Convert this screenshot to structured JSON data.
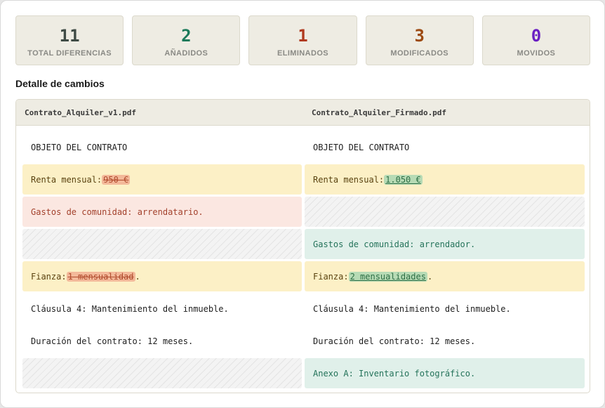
{
  "stats": [
    {
      "value": "11",
      "label": "TOTAL DIFERENCIAS",
      "color": "#3f4b45"
    },
    {
      "value": "2",
      "label": "AÑADIDOS",
      "color": "#1b7a5a"
    },
    {
      "value": "1",
      "label": "ELIMINADOS",
      "color": "#b03a1f"
    },
    {
      "value": "3",
      "label": "MODIFICADOS",
      "color": "#9c4a12"
    },
    {
      "value": "0",
      "label": "MOVIDOS",
      "color": "#6a1fc2"
    }
  ],
  "section_title": "Detalle de cambios",
  "files": {
    "left": "Contrato_Alquiler_v1.pdf",
    "right": "Contrato_Alquiler_Firmado.pdf"
  },
  "rows": {
    "r0": {
      "left": "OBJETO DEL CONTRATO",
      "right": "OBJETO DEL CONTRATO"
    },
    "r1": {
      "prefix": "Renta mensual:",
      "old": "950 €",
      "new": "1.050 €"
    },
    "r2": {
      "left": "Gastos de comunidad: arrendatario."
    },
    "r3": {
      "right": "Gastos de comunidad: arrendador."
    },
    "r4": {
      "prefix": "Fianza:",
      "old": "1 mensualidad",
      "new": "2 mensualidades",
      "suffix": "."
    },
    "r5": {
      "left": "Cláusula 4: Mantenimiento del inmueble.",
      "right": "Cláusula 4: Mantenimiento del inmueble."
    },
    "r6": {
      "left": "Duración del contrato: 12 meses.",
      "right": "Duración del contrato: 12 meses."
    },
    "r7": {
      "right": "Anexo A: Inventario fotográfico."
    }
  },
  "colors": {
    "modified": "#fcf0c6",
    "deleted": "#fbe7e1",
    "added": "#e0f0ea"
  }
}
